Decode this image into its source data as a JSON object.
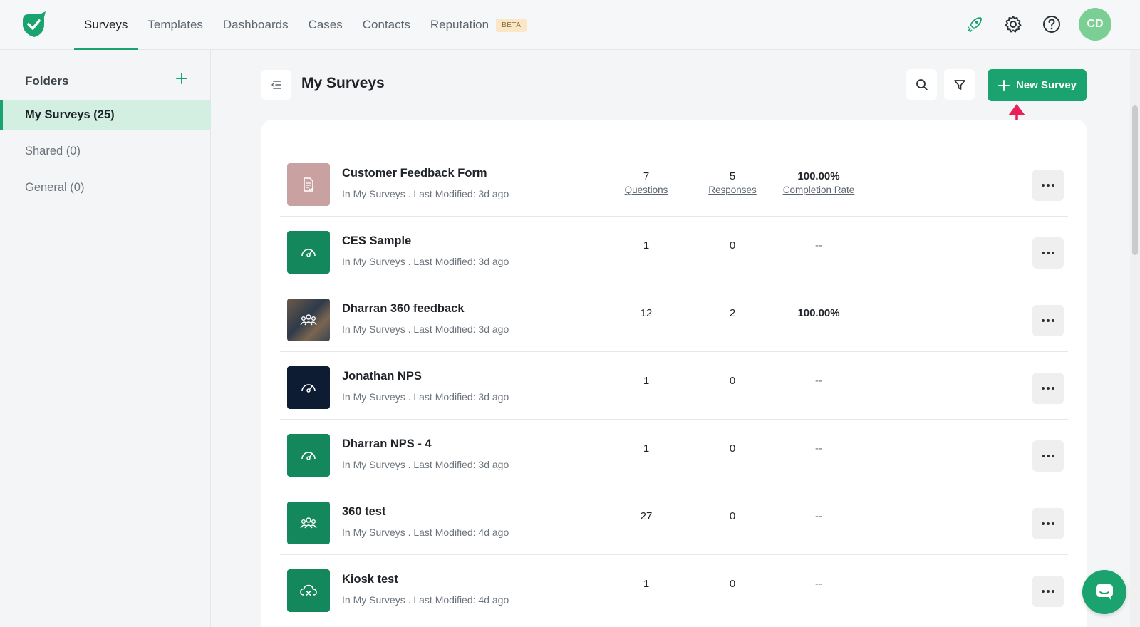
{
  "nav": {
    "items": [
      {
        "label": "Surveys",
        "active": true
      },
      {
        "label": "Templates",
        "active": false
      },
      {
        "label": "Dashboards",
        "active": false
      },
      {
        "label": "Cases",
        "active": false
      },
      {
        "label": "Contacts",
        "active": false
      },
      {
        "label": "Reputation",
        "active": false,
        "badge": "BETA"
      }
    ],
    "user_initials": "CD",
    "icons": [
      "rocket-icon",
      "gear-icon",
      "help-icon"
    ]
  },
  "sidebar": {
    "title": "Folders",
    "folders": [
      {
        "label": "My Surveys (25)",
        "active": true
      },
      {
        "label": "Shared (0)",
        "active": false
      },
      {
        "label": "General (0)",
        "active": false
      }
    ]
  },
  "main": {
    "title": "My Surveys",
    "new_button": "New Survey"
  },
  "labels": {
    "questions": "Questions",
    "responses": "Responses",
    "completion": "Completion Rate"
  },
  "surveys": [
    {
      "name": "Customer Feedback Form",
      "meta": "In My Surveys . Last Modified: 3d ago",
      "questions": "7",
      "responses": "5",
      "completion": "100.00%",
      "icon": "document-check-icon",
      "color": "#c9a1a1"
    },
    {
      "name": "CES Sample",
      "meta": "In My Surveys . Last Modified: 3d ago",
      "questions": "1",
      "responses": "0",
      "completion": "--",
      "icon": "gauge-icon",
      "color": "#15875d"
    },
    {
      "name": "Dharran 360 feedback",
      "meta": "In My Surveys . Last Modified: 3d ago",
      "questions": "12",
      "responses": "2",
      "completion": "100.00%",
      "icon": "group-icon",
      "color": "#4a5360"
    },
    {
      "name": "Jonathan NPS",
      "meta": "In My Surveys . Last Modified: 3d ago",
      "questions": "1",
      "responses": "0",
      "completion": "--",
      "icon": "gauge-icon",
      "color": "#0d1b33"
    },
    {
      "name": "Dharran NPS - 4",
      "meta": "In My Surveys . Last Modified: 3d ago",
      "questions": "1",
      "responses": "0",
      "completion": "--",
      "icon": "gauge-icon",
      "color": "#15875d"
    },
    {
      "name": "360 test",
      "meta": "In My Surveys . Last Modified: 4d ago",
      "questions": "27",
      "responses": "0",
      "completion": "--",
      "icon": "group-icon",
      "color": "#15875d"
    },
    {
      "name": "Kiosk test",
      "meta": "In My Surveys . Last Modified: 4d ago",
      "questions": "1",
      "responses": "0",
      "completion": "--",
      "icon": "cloud-x-icon",
      "color": "#15875d"
    }
  ]
}
